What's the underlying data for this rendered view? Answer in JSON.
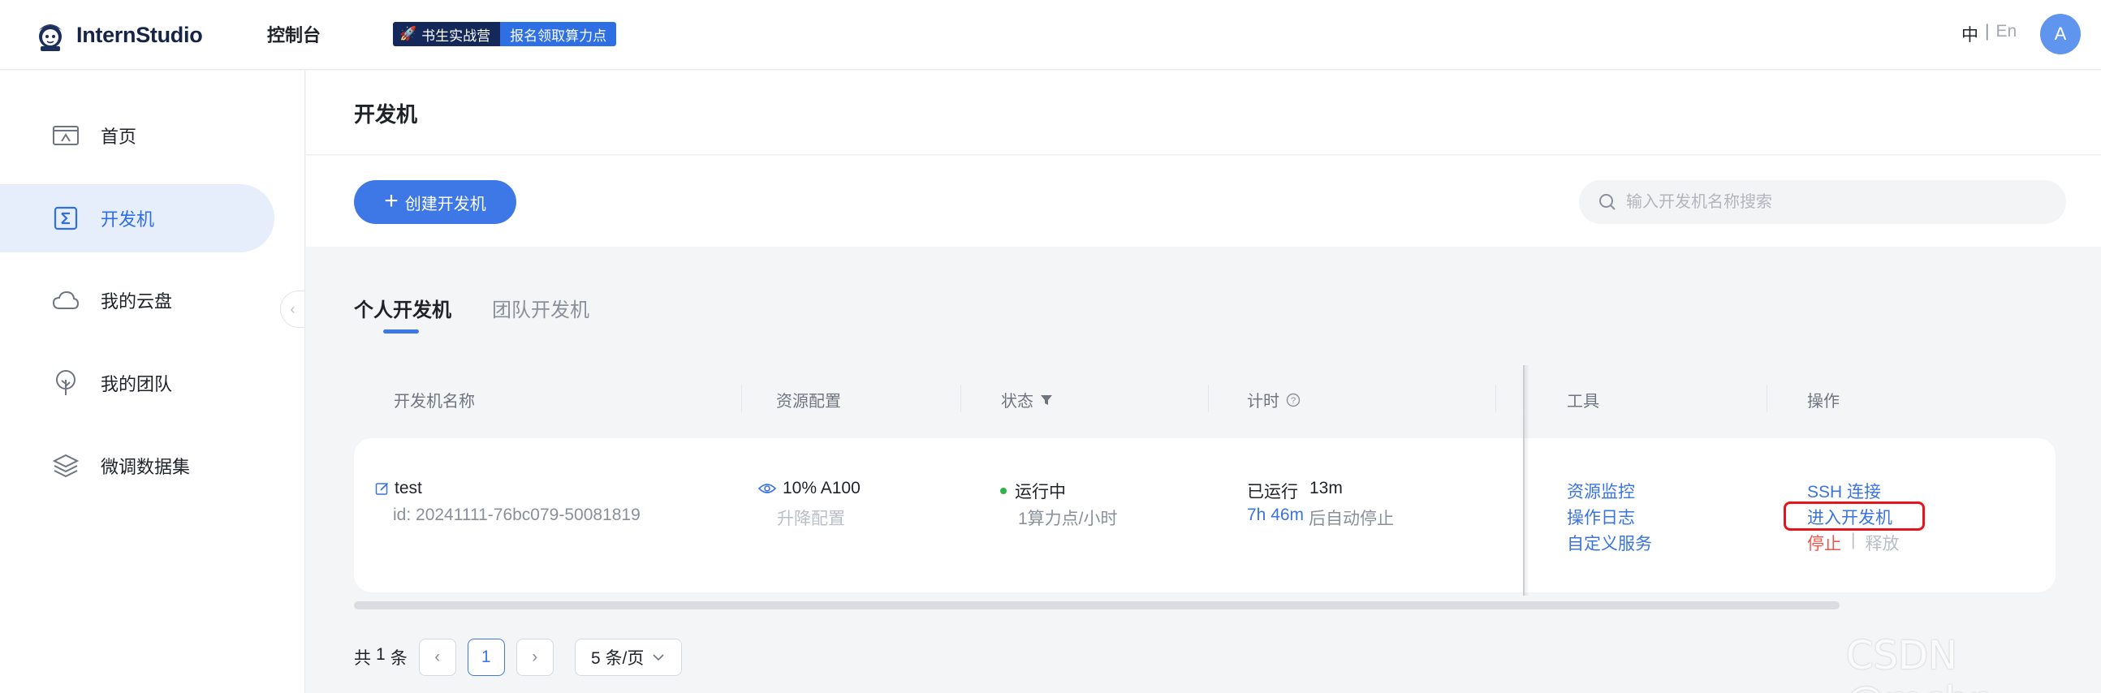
{
  "header": {
    "logo_text": "InternStudio",
    "nav_console": "控制台",
    "promo_left": "书生实战营",
    "promo_right": "报名领取算力点",
    "lang_cn": "中",
    "lang_sep": "|",
    "lang_en": "En",
    "avatar_initial": "A"
  },
  "sidebar": {
    "items": [
      {
        "label": "首页",
        "icon": "home-icon"
      },
      {
        "label": "开发机",
        "icon": "terminal-icon"
      },
      {
        "label": "我的云盘",
        "icon": "cloud-icon"
      },
      {
        "label": "我的团队",
        "icon": "team-icon"
      },
      {
        "label": "微调数据集",
        "icon": "layers-icon"
      }
    ],
    "active_index": 1
  },
  "main": {
    "title": "开发机",
    "create_button": "创建开发机",
    "search_placeholder": "输入开发机名称搜索",
    "tabs": [
      "个人开发机",
      "团队开发机"
    ],
    "table": {
      "headers": {
        "name": "开发机名称",
        "resources": "资源配置",
        "status": "状态",
        "timer": "计时",
        "tools": "工具",
        "actions": "操作"
      },
      "row": {
        "name": "test",
        "id": "id: 20241111-76bc079-50081819",
        "resource": "10% A100",
        "resource_action": "升降配置",
        "status": "运行中",
        "status_rate": "1算力点/小时",
        "timer_label": "已运行",
        "timer_value": "13m",
        "auto_stop_time": "7h 46m",
        "auto_stop_suffix": "后自动停止",
        "tools": [
          "资源监控",
          "操作日志",
          "自定义服务"
        ],
        "action_ssh": "SSH 连接",
        "action_enter": "进入开发机",
        "action_stop": "停止",
        "action_sep": "|",
        "action_release": "释放"
      }
    },
    "pagination": {
      "total_prefix": "共",
      "total_count": "1",
      "total_suffix": "条",
      "current_page": "1",
      "page_size": "5 条/页"
    }
  },
  "watermark": "CSDN @mchp",
  "colors": {
    "accent": "#3d78e6",
    "status_running": "#2fb344",
    "danger": "#f0554b",
    "highlight_box": "#e8141d"
  }
}
